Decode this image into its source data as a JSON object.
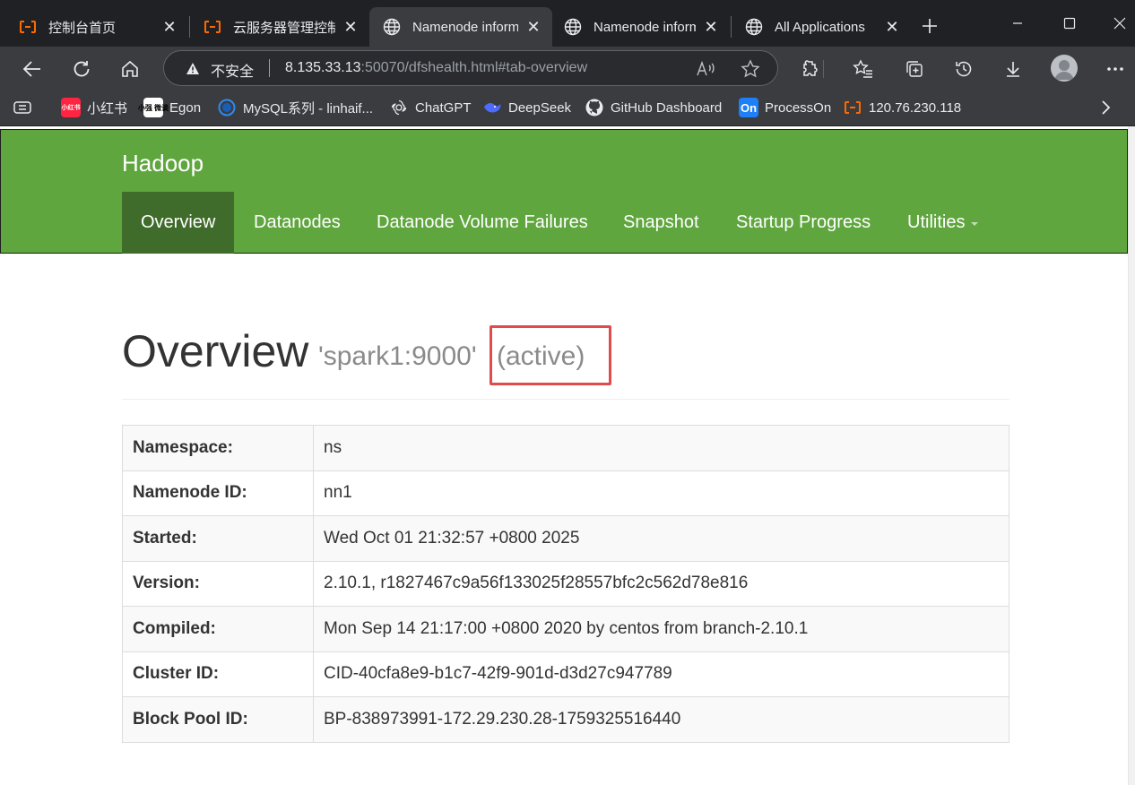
{
  "tabs": [
    {
      "title": "控制台首页",
      "active": false
    },
    {
      "title": "云服务器管理控制台",
      "active": false
    },
    {
      "title": "Namenode information",
      "active": true
    },
    {
      "title": "Namenode information",
      "active": false
    },
    {
      "title": "All Applications",
      "active": false
    }
  ],
  "address_bar": {
    "security_label": "不安全",
    "url_host": "8.135.33.13",
    "url_rest": ":50070/dfshealth.html#tab-overview"
  },
  "bookmarks": [
    {
      "label": "小红书",
      "icon_text": "小红书",
      "icon": "xiaohongshu-icon"
    },
    {
      "label": "Egon",
      "icon_text": "小强 微谈",
      "icon": "egon-icon"
    },
    {
      "label": "MySQL系列 - linhaif...",
      "icon": "circle-icon"
    },
    {
      "label": "ChatGPT",
      "icon": "chatgpt-icon"
    },
    {
      "label": "DeepSeek",
      "icon": "deepseek-icon"
    },
    {
      "label": "GitHub Dashboard",
      "icon": "github-icon"
    },
    {
      "label": "ProcessOn",
      "icon_text": "On",
      "icon": "processon-icon"
    },
    {
      "label": "120.76.230.118",
      "icon": "aliyun-icon"
    }
  ],
  "navbar": {
    "brand": "Hadoop",
    "items": [
      "Overview",
      "Datanodes",
      "Datanode Volume Failures",
      "Snapshot",
      "Startup Progress",
      "Utilities"
    ]
  },
  "overview": {
    "title": "Overview",
    "host": "'spark1:9000'",
    "state": "(active)"
  },
  "info_table": [
    {
      "label": "Namespace:",
      "value": "ns"
    },
    {
      "label": "Namenode ID:",
      "value": "nn1"
    },
    {
      "label": "Started:",
      "value": "Wed Oct 01 21:32:57 +0800 2025"
    },
    {
      "label": "Version:",
      "value": "2.10.1, r1827467c9a56f133025f28557bfc2c562d78e816"
    },
    {
      "label": "Compiled:",
      "value": "Mon Sep 14 21:17:00 +0800 2020 by centos from branch-2.10.1"
    },
    {
      "label": "Cluster ID:",
      "value": "CID-40cfa8e9-b1c7-42f9-901d-d3d27c947789"
    },
    {
      "label": "Block Pool ID:",
      "value": "BP-838973991-172.29.230.28-1759325516440"
    }
  ],
  "colors": {
    "navbar_green": "#5fa63e",
    "navbar_active": "#3f6c2b",
    "highlight_red": "#e24b4b",
    "aliyun_orange": "#ff6a00"
  }
}
